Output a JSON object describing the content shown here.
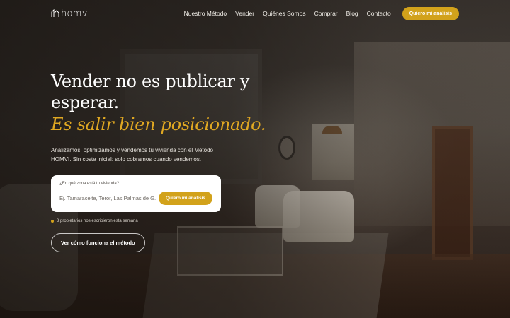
{
  "brand": {
    "logo_text": "homvi"
  },
  "nav": {
    "items": [
      {
        "label": "Nuestro Método"
      },
      {
        "label": "Vender"
      },
      {
        "label": "Quiénes Somos"
      },
      {
        "label": "Comprar"
      },
      {
        "label": "Blog"
      },
      {
        "label": "Contacto"
      }
    ],
    "cta_label": "Quiero mi análisis"
  },
  "hero": {
    "headline_line1": "Vender no es publicar y",
    "headline_line2": "esperar.",
    "headline_accent": "Es salir bien posicionado.",
    "subtext": "Analizamos, optimizamos y vendemos tu vivienda con el Método HOMVI. Sin coste inicial: solo cobramos cuando vendemos.",
    "search": {
      "label": "¿En qué zona está tu vivienda?",
      "placeholder": "Ej. Tamaraceite, Teror, Las Palmas de G.C",
      "button_label": "Quiero mi análisis"
    },
    "social_proof": "3 propietarios nos escribieron esta semana",
    "secondary_button_label": "Ver cómo funciona el método"
  },
  "colors": {
    "accent": "#d2a21b",
    "accent_text": "#e0a822"
  }
}
